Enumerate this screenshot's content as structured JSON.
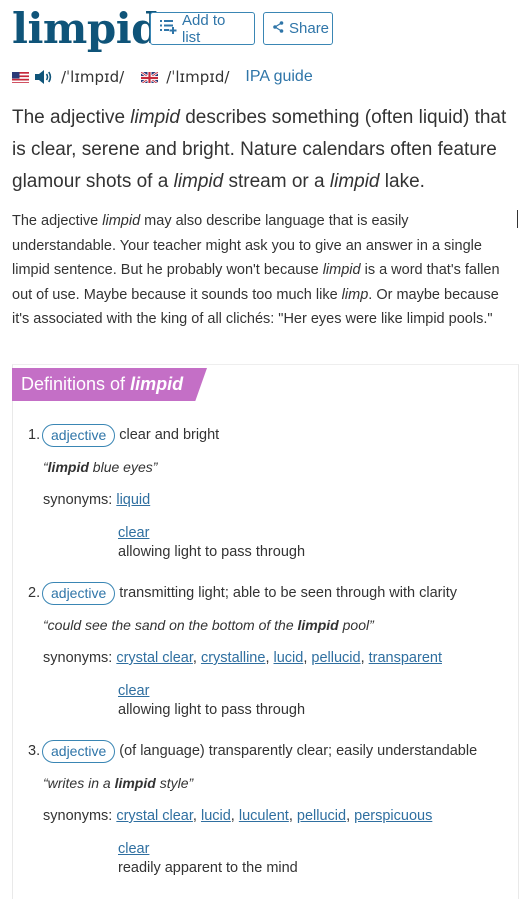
{
  "header": {
    "word": "limpid",
    "add_to_list_label": "Add to list",
    "share_label": "Share"
  },
  "pronunciation": {
    "us_ipa": "/ˈlɪmpɪd/",
    "uk_ipa": "/ˈlɪmpɪd/",
    "ipa_guide_label": "IPA guide"
  },
  "short_description": {
    "part1": "The adjective ",
    "em1": "limpid",
    "part2": " describes something (often liquid) that is clear, serene and bright. Nature calendars often feature glamour shots of a ",
    "em2": "limpid",
    "part3": " stream or a ",
    "em3": "limpid",
    "part4": " lake."
  },
  "long_description": {
    "p1": "The adjective ",
    "e1": "limpid",
    "p2": " may also describe language that is easily understandable. Your teacher might ask you to give an answer in a single limpid sentence. But he probably won't because ",
    "e2": "limpid",
    "p3": " is a word that's fallen out of use. Maybe because it sounds too much like ",
    "e3": "limp",
    "p4": ". Or maybe because it's associated with the king of all clichés: \"Her eyes were like limpid pools.\""
  },
  "definitions": {
    "tab_prefix": "Definitions of ",
    "tab_word": "limpid",
    "synonyms_label": "synonyms:",
    "senses": [
      {
        "number": "1.",
        "pos": "adjective",
        "definition": "clear and bright",
        "example_pre": "“",
        "example_bold": "limpid",
        "example_post": " blue eyes”",
        "synonyms": [
          "liquid"
        ],
        "related": {
          "word": "clear",
          "definition": "allowing light to pass through"
        }
      },
      {
        "number": "2.",
        "pos": "adjective",
        "definition": "transmitting light; able to be seen through with clarity",
        "example_pre": "“could see the sand on the bottom of the ",
        "example_bold": "limpid",
        "example_post": " pool”",
        "synonyms": [
          "crystal clear",
          "crystalline",
          "lucid",
          "pellucid",
          "transparent"
        ],
        "related": {
          "word": "clear",
          "definition": "allowing light to pass through"
        }
      },
      {
        "number": "3.",
        "pos": "adjective",
        "definition": "(of language) transparently clear; easily understandable",
        "example_pre": "“writes in a ",
        "example_bold": "limpid",
        "example_post": " style”",
        "synonyms": [
          "crystal clear",
          "lucid",
          "luculent",
          "pellucid",
          "perspicuous"
        ],
        "related": {
          "word": "clear",
          "definition": "readily apparent to the mind"
        }
      }
    ]
  },
  "colors": {
    "word_title": "#0f5479",
    "link": "#2f75a8",
    "definitions_tab": "#c46fc6"
  },
  "icons": {
    "add_to_list": "list-add-icon",
    "share": "share-icon",
    "us_flag": "us-flag-icon",
    "audio": "speaker-icon",
    "uk_flag": "uk-flag-icon"
  }
}
